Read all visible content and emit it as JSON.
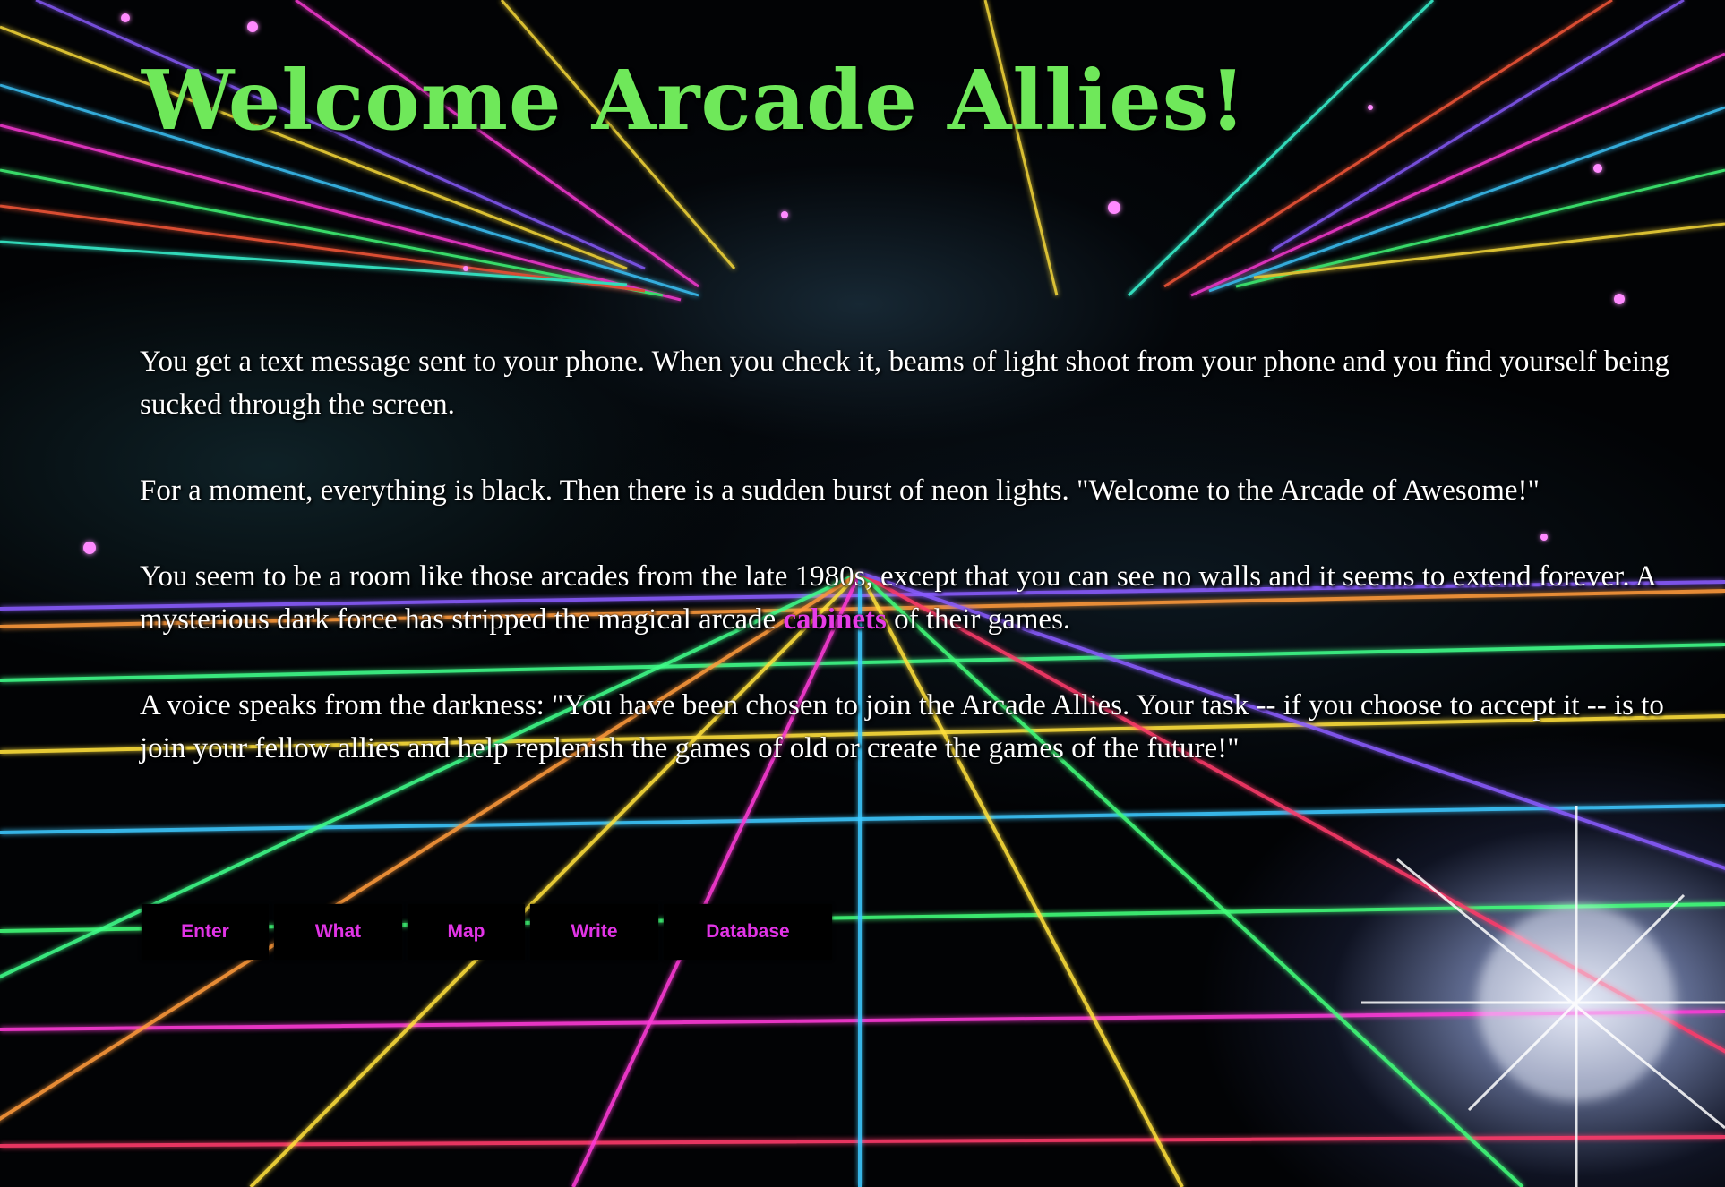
{
  "page": {
    "title": "Welcome Arcade Allies!"
  },
  "story": {
    "p1": "You get a text message sent to your phone. When you check it, beams of light shoot from your phone and you find yourself being sucked through the screen.",
    "p2": "For a moment, everything is black. Then there is a sudden burst of neon lights. \"Welcome to the Arcade of Awesome!\"",
    "p3_before": "You seem to be a room like those arcades from the late 1980s, except that you can see no walls and it seems to extend forever. A mysterious dark force has stripped the magical arcade ",
    "p3_link": "cabinets",
    "p3_after": " of their games.",
    "p4": "A voice speaks from the darkness: \"You have been chosen to join the Arcade Allies. Your task -- if you choose to accept it -- is to join your fellow allies and help replenish the games of old or create the games of the future!\""
  },
  "nav": {
    "items": [
      {
        "label": "Enter"
      },
      {
        "label": "What"
      },
      {
        "label": "Map"
      },
      {
        "label": "Write"
      },
      {
        "label": "Database"
      }
    ]
  },
  "colors": {
    "title": "#6fe85a",
    "link": "#e63ce6",
    "nav_text": "#e134e6",
    "nav_bg": "#000000",
    "body_text": "#ffffff"
  }
}
